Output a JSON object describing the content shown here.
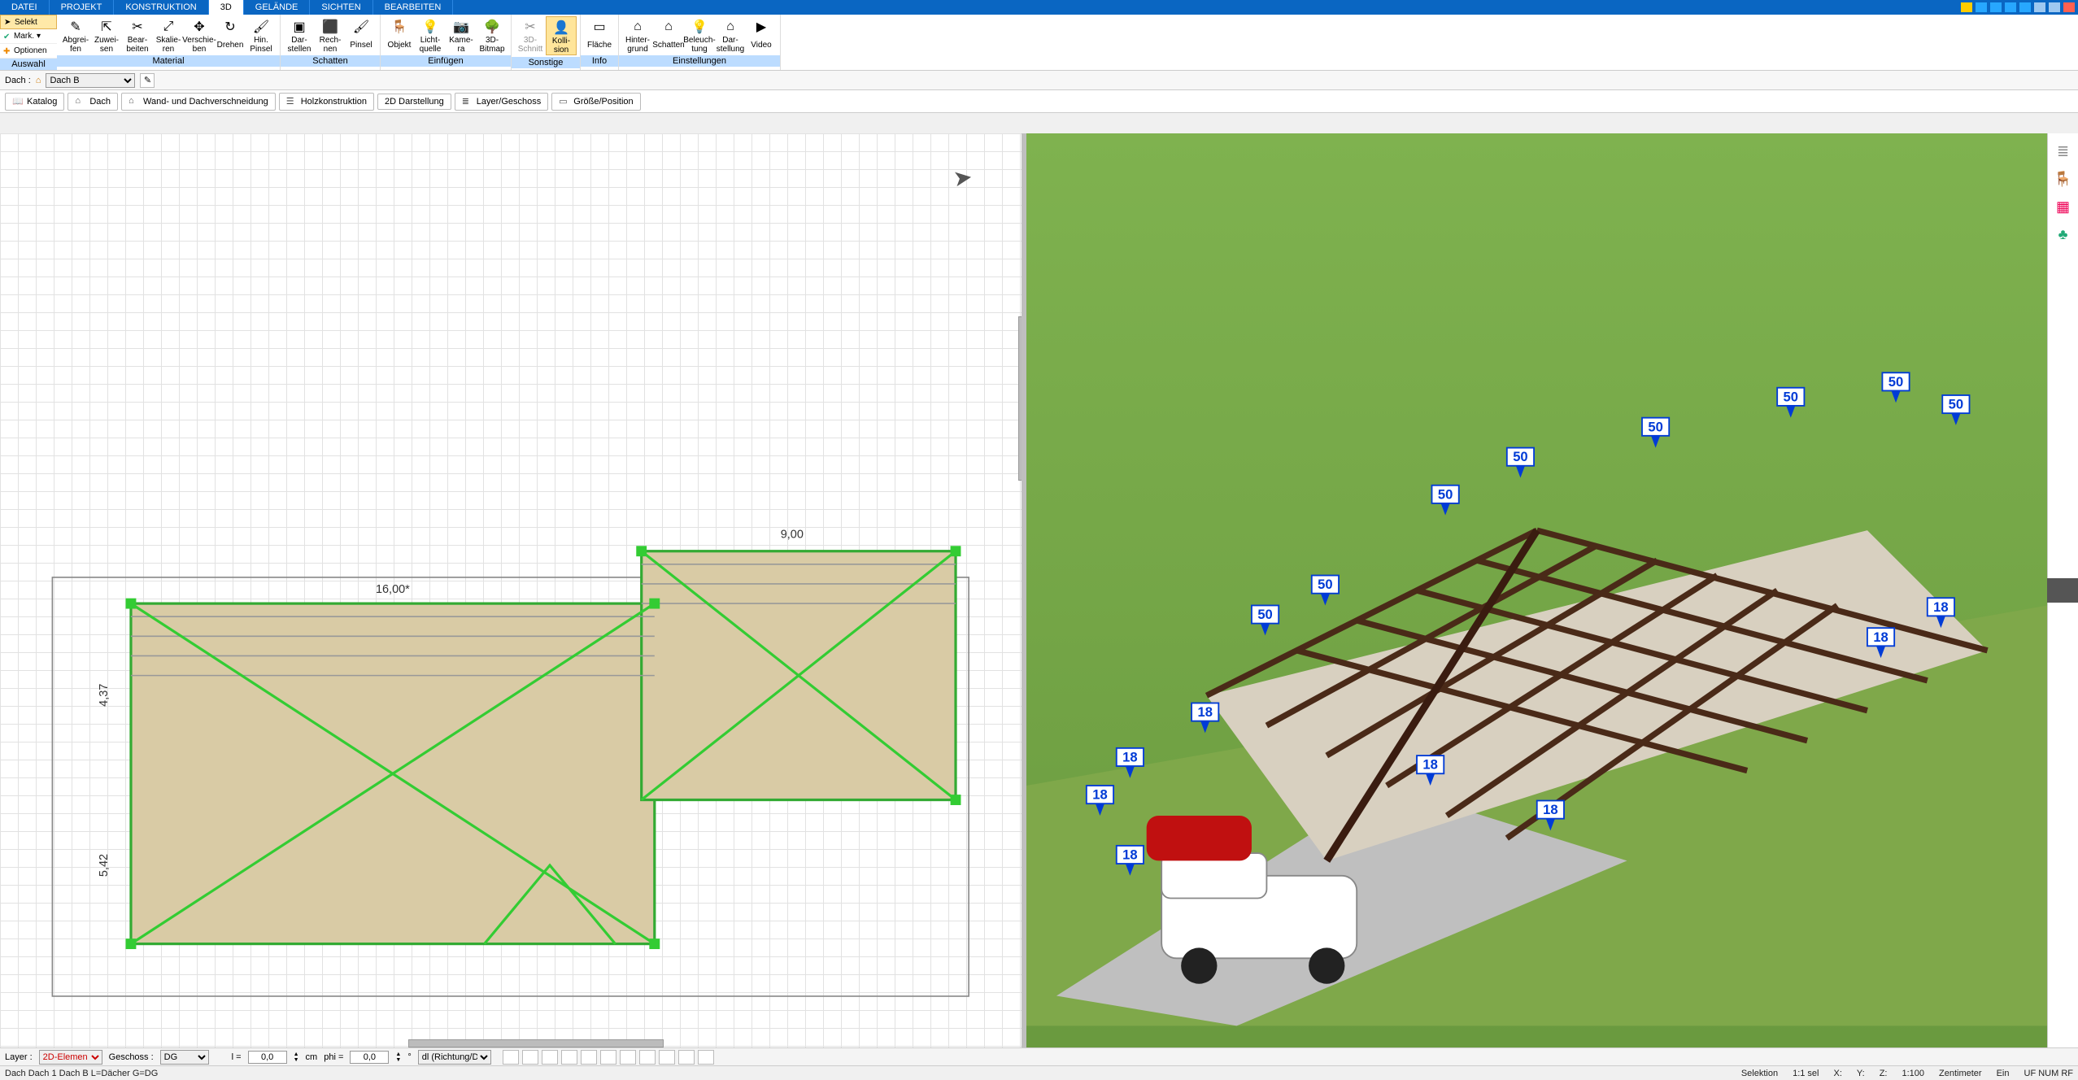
{
  "menu": {
    "tabs": [
      "DATEI",
      "PROJEKT",
      "KONSTRUKTION",
      "3D",
      "GELÄNDE",
      "SICHTEN",
      "BEARBEITEN"
    ],
    "active": "3D"
  },
  "ribbon_left": {
    "selekt": "Selekt",
    "mark": "Mark.",
    "optionen": "Optionen",
    "caption": "Auswahl"
  },
  "ribbon_groups": [
    {
      "caption": "Material",
      "items": [
        {
          "label": "Abgrei-\nfen"
        },
        {
          "label": "Zuwei-\nsen"
        },
        {
          "label": "Bear-\nbeiten"
        },
        {
          "label": "Skalie-\nren"
        },
        {
          "label": "Verschie-\nben"
        },
        {
          "label": "Drehen"
        },
        {
          "label": "Hin.\nPinsel"
        }
      ]
    },
    {
      "caption": "Schatten",
      "items": [
        {
          "label": "Dar-\nstellen"
        },
        {
          "label": "Rech-\nnen"
        },
        {
          "label": "Pinsel"
        }
      ]
    },
    {
      "caption": "Einfügen",
      "items": [
        {
          "label": "Objekt"
        },
        {
          "label": "Licht-\nquelle"
        },
        {
          "label": "Kame-\nra"
        },
        {
          "label": "3D-\nBitmap"
        }
      ]
    },
    {
      "caption": "Sonstige",
      "items": [
        {
          "label": "3D-\nSchnitt",
          "disabled": true
        },
        {
          "label": "Kolli-\nsion",
          "hl": true
        }
      ]
    },
    {
      "caption": "Info",
      "items": [
        {
          "label": "Fläche"
        }
      ]
    },
    {
      "caption": "Einstellungen",
      "items": [
        {
          "label": "Hinter-\ngrund"
        },
        {
          "label": "Schatten"
        },
        {
          "label": "Beleuch-\ntung"
        },
        {
          "label": "Dar-\nstellung"
        },
        {
          "label": "Video"
        }
      ]
    }
  ],
  "quickprop": {
    "label": "Dach :",
    "value": "Dach B"
  },
  "subtool": [
    {
      "label": "Katalog",
      "ico": "📖"
    },
    {
      "label": "Dach",
      "ico": "⌂"
    },
    {
      "label": "Wand- und Dachverschneidung",
      "ico": "⌂"
    },
    {
      "label": "Holzkonstruktion",
      "ico": "☰"
    },
    {
      "label": "2D Darstellung",
      "ico": ""
    },
    {
      "label": "Layer/Geschoss",
      "ico": "≣"
    },
    {
      "label": "Größe/Position",
      "ico": "▭"
    }
  ],
  "bottombar": {
    "layer_label": "Layer :",
    "layer_value": "2D-Elemen",
    "geschoss_label": "Geschoss :",
    "geschoss_value": "DG",
    "l_label": "l =",
    "l_value": "0,0",
    "cm": "cm",
    "phi_label": "phi =",
    "phi_value": "0,0",
    "deg": "°",
    "dir_value": "dl (Richtung/Di"
  },
  "statusbar": {
    "left": "Dach Dach 1 Dach B L=Dächer G=DG",
    "sel": "Selektion",
    "ratio": "1:1 sel",
    "x": "X:",
    "y": "Y:",
    "z": "Z:",
    "scale": "1:100",
    "unit": "Zentimeter",
    "ein": "Ein",
    "uf": "UF NUM RF"
  },
  "plan": {
    "dim_top1": "9,00",
    "dim_top2": "16,00*",
    "dim_left1": "4,37",
    "dim_left2": "5,42"
  },
  "marker_big": "50",
  "marker_small": "18"
}
